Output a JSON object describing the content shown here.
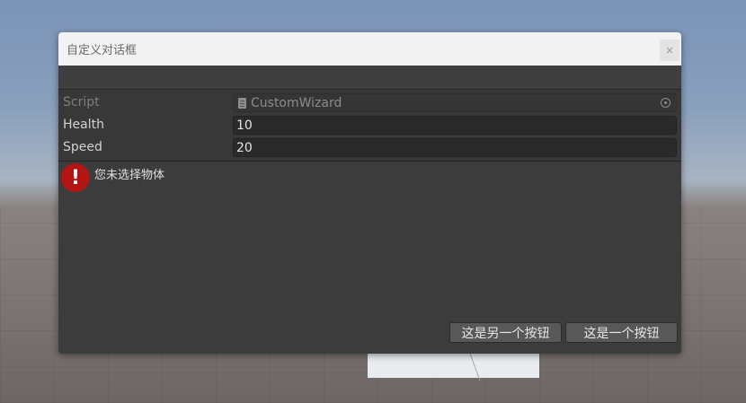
{
  "window": {
    "title": "自定义对话框",
    "close_glyph": "×"
  },
  "inspector": {
    "script_label": "Script",
    "script_value": "CustomWizard",
    "fields": [
      {
        "label": "Health",
        "value": "10"
      },
      {
        "label": "Speed",
        "value": "20"
      }
    ]
  },
  "message": {
    "icon_glyph": "!",
    "text": "您未选择物体",
    "type": "error"
  },
  "buttons": {
    "secondary_label": "这是另一个按钮",
    "primary_label": "这是一个按钮"
  },
  "colors": {
    "error_red": "#b31414",
    "panel_bg": "#383838"
  },
  "icons": {
    "script": "script-file-icon",
    "object_picker": "object-picker-icon",
    "error": "error-icon",
    "close": "close-icon"
  }
}
